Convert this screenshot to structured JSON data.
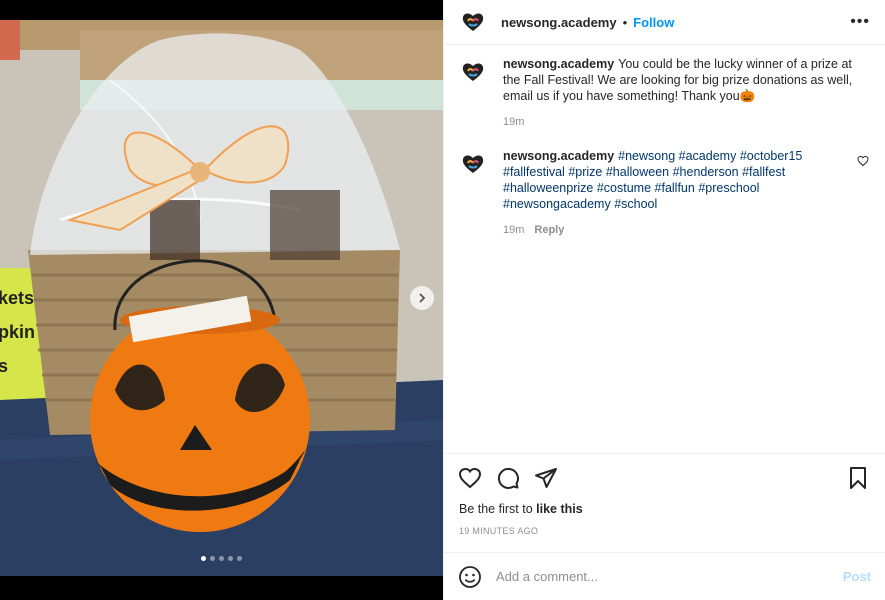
{
  "header": {
    "username": "newsong.academy",
    "separator": "•",
    "follow_label": "Follow",
    "more_label": "•••"
  },
  "caption": {
    "username": "newsong.academy",
    "text": "You could be the lucky winner of a prize at the Fall Festival! We are looking for big prize donations as well, email us if you have something! Thank you",
    "emoji": "🎃",
    "time": "19m"
  },
  "comment": {
    "username": "newsong.academy",
    "hashtags": [
      "#newsong",
      "#academy",
      "#october15",
      "#fallfestival",
      "#prize",
      "#halloween",
      "#henderson",
      "#fallfest",
      "#halloweenprize",
      "#costume",
      "#fallfun",
      "#preschool",
      "#newsongacademy",
      "#school"
    ],
    "time": "19m",
    "reply_label": "Reply"
  },
  "likes": {
    "prefix": "Be the first to ",
    "link": "like this"
  },
  "timestamp": "19 MINUTES AGO",
  "add_comment": {
    "placeholder": "Add a comment...",
    "post_label": "Post"
  },
  "carousel": {
    "slide_count": 5,
    "active_index": 0
  },
  "colors": {
    "link_blue": "#0095f6",
    "hashtag": "#00376b",
    "muted": "#8e8e8e",
    "pumpkin": "#f07a12"
  },
  "icons": [
    "heart-icon",
    "comment-icon",
    "share-icon",
    "bookmark-icon",
    "emoji-icon",
    "chevron-right-icon",
    "more-icon"
  ]
}
